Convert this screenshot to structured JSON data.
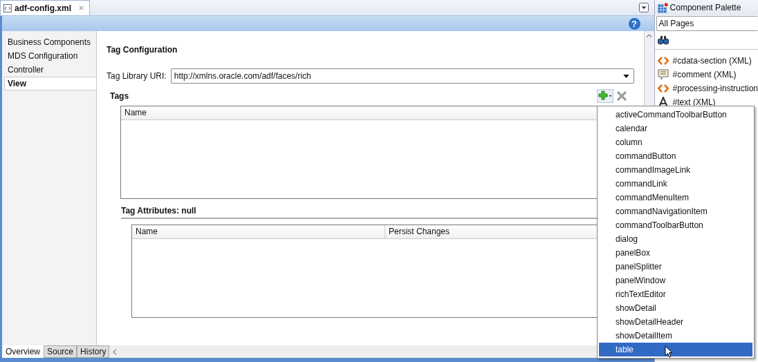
{
  "editor_tab": {
    "title": "adf-config.xml"
  },
  "sidebar": {
    "items": [
      {
        "label": "Business Components",
        "selected": false
      },
      {
        "label": "MDS Configuration",
        "selected": false
      },
      {
        "label": "Controller",
        "selected": false
      },
      {
        "label": "View",
        "selected": true
      }
    ]
  },
  "help": {
    "glyph": "?"
  },
  "section_title": "Tag Configuration",
  "tag_library": {
    "label": "Tag Library URI:",
    "value": "http://xmlns.oracle.com/adf/faces/rich"
  },
  "tags": {
    "title": "Tags",
    "table": {
      "columns": [
        "Name"
      ]
    }
  },
  "tag_attributes": {
    "title": "Tag Attributes: null",
    "table": {
      "columns": [
        "Name",
        "Persist Changes"
      ]
    }
  },
  "bottom_tabs": [
    {
      "label": "Overview",
      "selected": true
    },
    {
      "label": "Source",
      "selected": false
    },
    {
      "label": "History",
      "selected": false
    }
  ],
  "palette": {
    "title": "Component Palette",
    "page_selector": "All Pages",
    "items": [
      {
        "label": "#cdata-section (XML)",
        "kind": "xml"
      },
      {
        "label": "#comment (XML)",
        "kind": "comment"
      },
      {
        "label": "#processing-instruction",
        "kind": "xml"
      },
      {
        "label": "#text (XML)",
        "kind": "text"
      }
    ]
  },
  "add_menu": {
    "items": [
      {
        "label": "activeCommandToolbarButton",
        "selected": false
      },
      {
        "label": "calendar",
        "selected": false
      },
      {
        "label": "column",
        "selected": false
      },
      {
        "label": "commandButton",
        "selected": false
      },
      {
        "label": "commandImageLink",
        "selected": false
      },
      {
        "label": "commandLink",
        "selected": false
      },
      {
        "label": "commandMenuItem",
        "selected": false
      },
      {
        "label": "commandNavigationItem",
        "selected": false
      },
      {
        "label": "commandToolbarButton",
        "selected": false
      },
      {
        "label": "dialog",
        "selected": false
      },
      {
        "label": "panelBox",
        "selected": false
      },
      {
        "label": "panelSplitter",
        "selected": false
      },
      {
        "label": "panelWindow",
        "selected": false
      },
      {
        "label": "richTextEditor",
        "selected": false
      },
      {
        "label": "showDetail",
        "selected": false
      },
      {
        "label": "showDetailHeader",
        "selected": false
      },
      {
        "label": "showDetailItem",
        "selected": false
      },
      {
        "label": "table",
        "selected": true
      }
    ]
  }
}
